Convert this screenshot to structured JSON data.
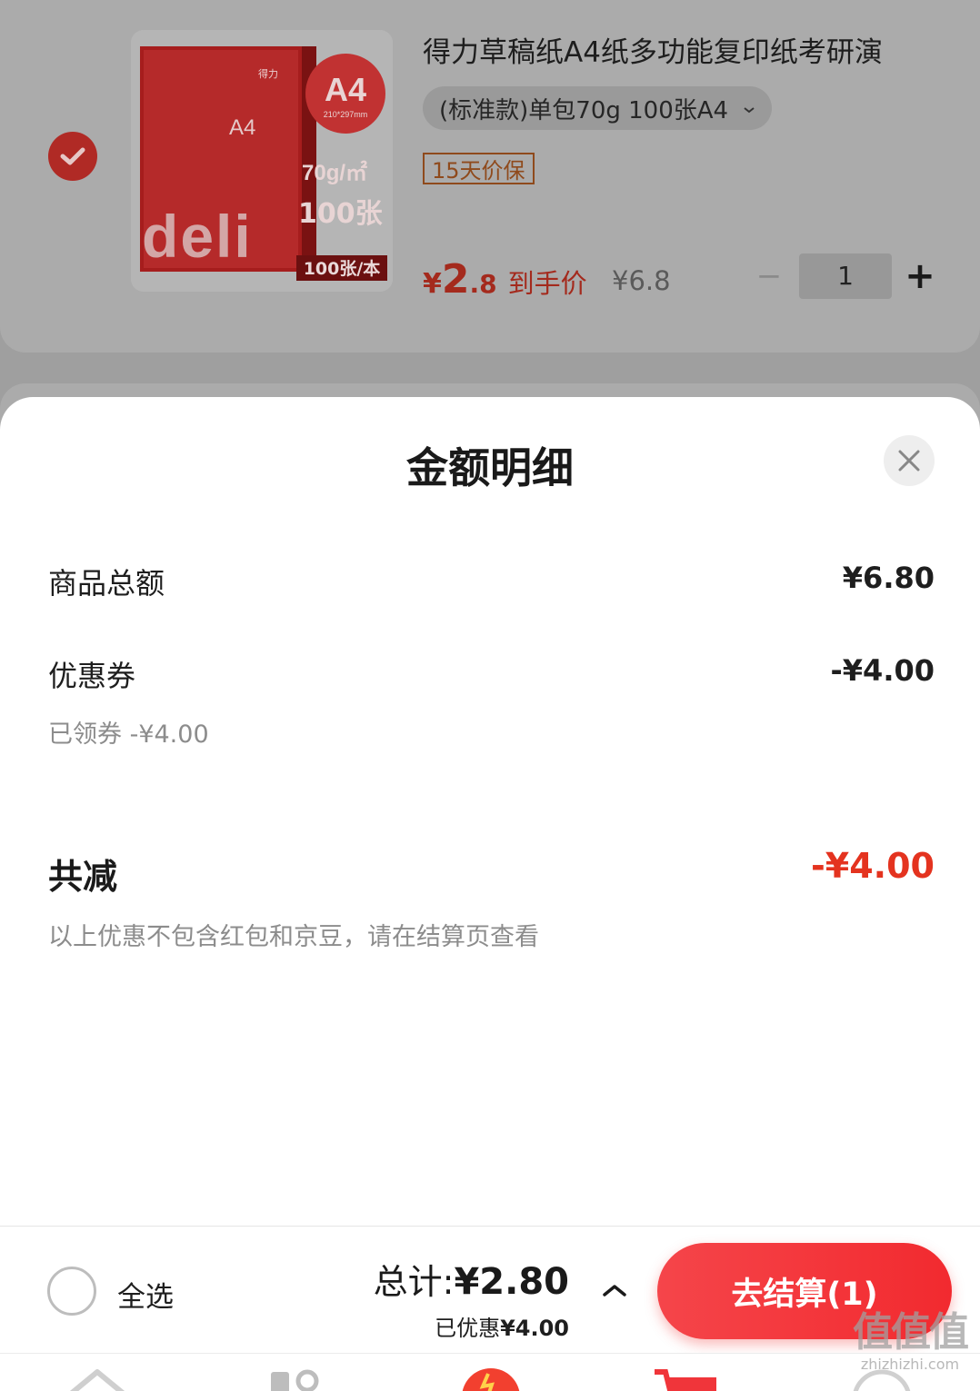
{
  "cart_item": {
    "title": "得力草稿纸A4纸多功能复印纸考研演",
    "sku": "(标准款)单包70g 100张A4",
    "badge": "15天价保",
    "price_currency": "¥",
    "price_int": "2",
    "price_dec": ".8",
    "price_tag": "到手价",
    "original_price": "¥6.8",
    "quantity": "1",
    "qty_minus": "−",
    "qty_plus": "+",
    "image": {
      "brand": "deli",
      "brand_cn": "得力",
      "size_label": "A4",
      "size_dims": "210*297mm",
      "weight": "70g/㎡",
      "count": "100张",
      "count_pack": "100张/本",
      "inner_label": "A4"
    }
  },
  "sheet": {
    "title": "金额明细",
    "rows": [
      {
        "label": "商品总额",
        "value": "¥6.80"
      },
      {
        "label": "优惠券",
        "value": "-¥4.00",
        "sub": "已领券 -¥4.00"
      }
    ],
    "total_label": "共减",
    "total_value": "-¥4.00",
    "note": "以上优惠不包含红包和京豆，请在结算页查看"
  },
  "bottom_bar": {
    "select_all_label": "全选",
    "total_label": "总计:",
    "total_amount": "¥2.80",
    "saved_label": "已优惠",
    "saved_amount": "¥4.00",
    "checkout_label": "去结算(1)"
  },
  "watermark": {
    "big": "值值值",
    "small": "zhizhizhi.com"
  },
  "colors": {
    "accent_red": "#f22a2f",
    "discount_red": "#e4331f",
    "badge_brown": "#8f4a1c"
  }
}
